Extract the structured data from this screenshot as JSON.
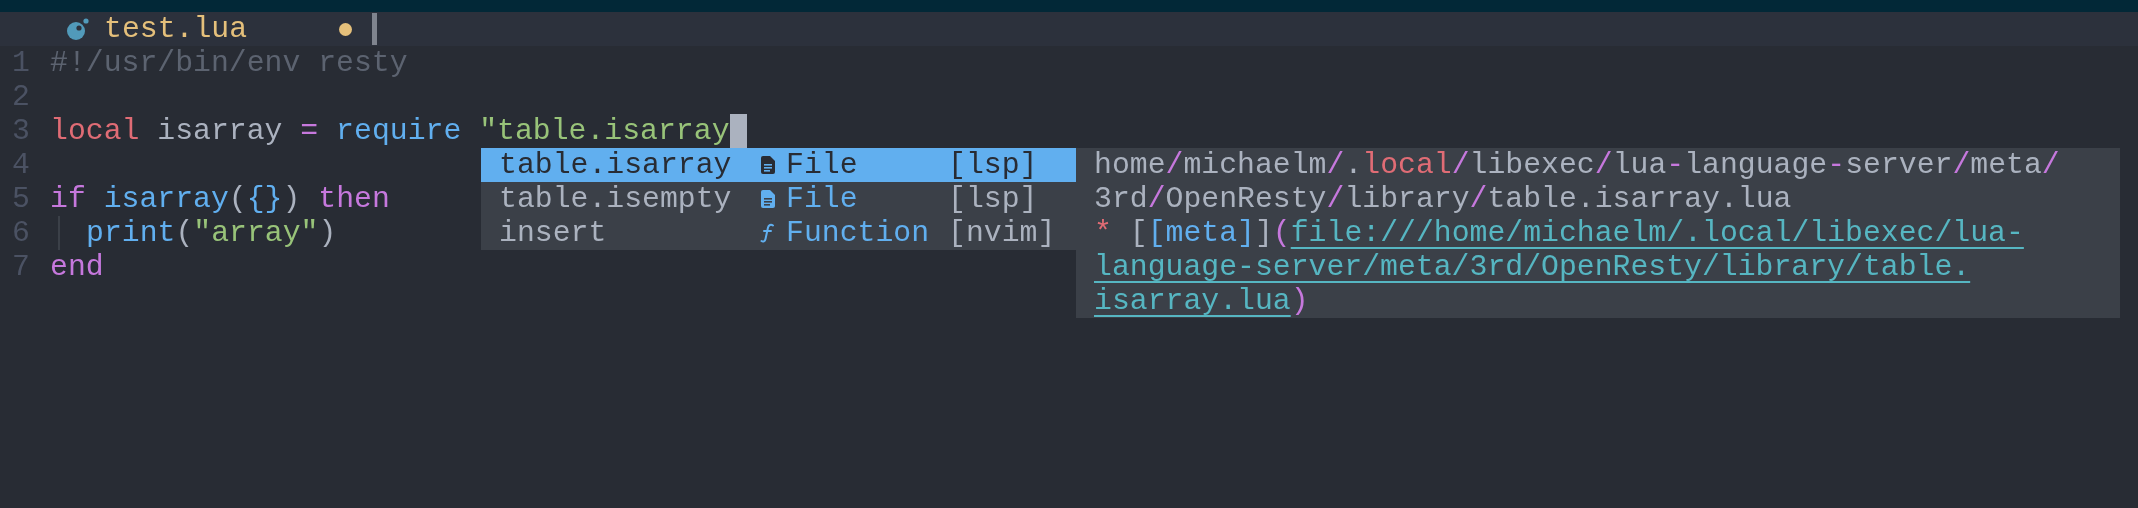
{
  "tab": {
    "title": "test.lua",
    "modified": true
  },
  "code_lines": [
    {
      "number": "1",
      "tokens": [
        {
          "text": "#!/usr/bin/env resty",
          "kind": "comment"
        }
      ]
    },
    {
      "number": "2"
    },
    {
      "number": "3",
      "tokens": [
        {
          "text": "local",
          "kind": "keyword"
        },
        {
          "text": " isarray ",
          "kind": "ident"
        },
        {
          "text": "=",
          "kind": "operator"
        },
        {
          "text": " require",
          "kind": "function"
        },
        {
          "text": " \"table.isarray",
          "kind": "string"
        }
      ],
      "cursor": true
    },
    {
      "number": "4"
    },
    {
      "number": "5",
      "tokens": [
        {
          "text": "if",
          "kind": "control"
        },
        {
          "text": " isarray",
          "kind": "function"
        },
        {
          "text": "(",
          "kind": "ident"
        },
        {
          "text": "{}",
          "kind": "function"
        },
        {
          "text": ") ",
          "kind": "ident"
        },
        {
          "text": "then",
          "kind": "control"
        }
      ]
    },
    {
      "number": "6",
      "indent_guide": true,
      "tokens": [
        {
          "text": "print",
          "kind": "function"
        },
        {
          "text": "(",
          "kind": "ident"
        },
        {
          "text": "\"array\"",
          "kind": "string"
        },
        {
          "text": ")",
          "kind": "ident"
        }
      ]
    },
    {
      "number": "7",
      "tokens": [
        {
          "text": "end",
          "kind": "control"
        }
      ]
    }
  ],
  "completion": {
    "items": [
      {
        "label": "table.isarray",
        "kind": "file",
        "kind_label": "File",
        "source": "[lsp]",
        "selected": true
      },
      {
        "label": "table.isempty",
        "kind": "file",
        "kind_label": "File",
        "source": "[lsp]",
        "selected": false
      },
      {
        "label": "insert",
        "kind": "function",
        "kind_label": "Function",
        "source": "[nvim]",
        "selected": false
      }
    ]
  },
  "documentation": {
    "lines": [
      [
        {
          "text": "home",
          "kind": "text"
        },
        {
          "text": "/",
          "kind": "sep"
        },
        {
          "text": "michaelm",
          "kind": "text"
        },
        {
          "text": "/",
          "kind": "sep"
        },
        {
          "text": ".",
          "kind": "text"
        },
        {
          "text": "local",
          "kind": "keyword"
        },
        {
          "text": "/",
          "kind": "sep"
        },
        {
          "text": "libexec",
          "kind": "text"
        },
        {
          "text": "/",
          "kind": "sep"
        },
        {
          "text": "lua",
          "kind": "text"
        },
        {
          "text": "-",
          "kind": "sep"
        },
        {
          "text": "language",
          "kind": "text"
        },
        {
          "text": "-",
          "kind": "sep"
        },
        {
          "text": "server",
          "kind": "text"
        },
        {
          "text": "/",
          "kind": "sep"
        },
        {
          "text": "meta",
          "kind": "text"
        },
        {
          "text": "/",
          "kind": "sep"
        }
      ],
      [
        {
          "text": "3rd",
          "kind": "text"
        },
        {
          "text": "/",
          "kind": "sep"
        },
        {
          "text": "OpenResty",
          "kind": "text"
        },
        {
          "text": "/",
          "kind": "sep"
        },
        {
          "text": "library",
          "kind": "text"
        },
        {
          "text": "/",
          "kind": "sep"
        },
        {
          "text": "table.isarray.lua",
          "kind": "text"
        }
      ],
      [
        {
          "text": "*",
          "kind": "keyword"
        },
        {
          "text": " [",
          "kind": "text"
        },
        {
          "text": "[meta]",
          "kind": "label"
        },
        {
          "text": "]",
          "kind": "text"
        },
        {
          "text": "(",
          "kind": "sep"
        },
        {
          "text": "file:///home/michaelm/.local/libexec/lua-",
          "kind": "link"
        }
      ],
      [
        {
          "text": "language-server/meta/3rd/OpenResty/library/table.",
          "kind": "link"
        }
      ],
      [
        {
          "text": "isarray.lua",
          "kind": "link"
        },
        {
          "text": ")",
          "kind": "sep"
        }
      ]
    ]
  }
}
